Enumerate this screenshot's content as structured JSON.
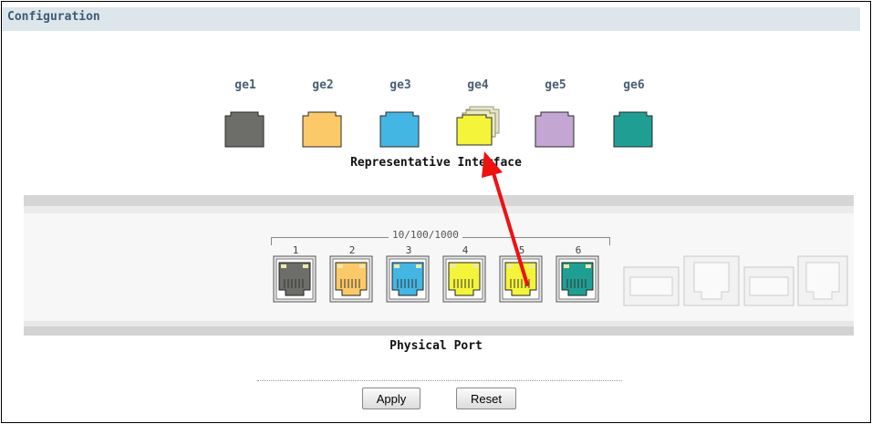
{
  "section": {
    "title": "Configuration"
  },
  "interfaces": [
    {
      "label": "ge1",
      "color": "#6d6e6a"
    },
    {
      "label": "ge2",
      "color": "#fbc968"
    },
    {
      "label": "ge3",
      "color": "#44b6e4"
    },
    {
      "label": "ge4",
      "color": "#f4f43b"
    },
    {
      "label": "ge5",
      "color": "#c3a6d1"
    },
    {
      "label": "ge6",
      "color": "#1f9f93"
    }
  ],
  "representative_caption": "Representative Interface",
  "physical": {
    "speed_label": "10/100/1000",
    "ports": [
      {
        "number": "1",
        "color": "#6d6e6a"
      },
      {
        "number": "2",
        "color": "#fbc968"
      },
      {
        "number": "3",
        "color": "#44b6e4"
      },
      {
        "number": "4",
        "color": "#f4f43b"
      },
      {
        "number": "5",
        "color": "#f4f43b"
      },
      {
        "number": "6",
        "color": "#1f9f93"
      }
    ],
    "caption": "Physical Port"
  },
  "buttons": {
    "apply": "Apply",
    "reset": "Reset"
  },
  "annotation_color": "#ee1111"
}
